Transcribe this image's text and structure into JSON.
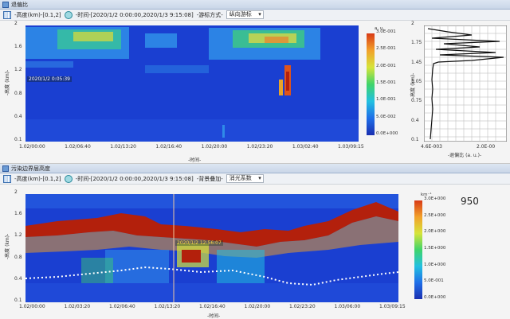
{
  "top": {
    "title": "退偏比",
    "toolbar": {
      "height_label": "-高度(km)-[0.1,2]",
      "time_label": "-时间-[2020/1/2 0:00:00,2020/1/3 9:15:08]",
      "cursor_label": "-游标方式-",
      "cursor_value": "纵向游标"
    },
    "ylabel": "-高度 (km)-",
    "xlabel": "-时间-",
    "yticks": [
      "2",
      "1.6",
      "1.2",
      "0.8",
      "0.4",
      "0.1"
    ],
    "xticks": [
      "1.02/00:00",
      "1.02/06:40",
      "1.02/13:20",
      "1.02/16:40",
      "1.02/20:00",
      "1.02/23:20",
      "1.03/02:40",
      "1.03/09:15"
    ],
    "stamp": "2020/1/2 0:05:39",
    "cbar_unit": "a. u.",
    "cbar_ticks": [
      "3.0E-001",
      "2.5E-001",
      "2.0E-001",
      "1.5E-001",
      "1.0E-001",
      "5.0E-002",
      "0.0E+000"
    ],
    "profile": {
      "yticks": [
        "2",
        "1.75",
        "1.45",
        "1.05",
        "0.75",
        "0.4",
        "0.1"
      ],
      "ylabel": "-高度 (km)-",
      "xticks": [
        "4.6E-003",
        "2.0E-00"
      ],
      "xlabel": "-退偏比 (a. u.)-"
    }
  },
  "bottom": {
    "title": "污染边界层高度",
    "toolbar": {
      "height_label": "-高度(km)-[0.1,2]",
      "time_label": "-时间-[2020/1/2 0:00:00,2020/1/3 9:15:08]",
      "bg_label": "-背景叠加-",
      "bg_value": "消光系数"
    },
    "ylabel": "-高度 (km)-",
    "xlabel": "-时间-",
    "yticks": [
      "2",
      "1.6",
      "1.2",
      "0.8",
      "0.4",
      "0.1"
    ],
    "xticks": [
      "1.02/00:00",
      "1.02/03:20",
      "1.02/06:40",
      "1.02/13:20",
      "1.02/16:40",
      "1.02/20:00",
      "1.02/23:20",
      "1.03/06:00",
      "1.03/09:15"
    ],
    "stamp": "2020/1/2 12:56:07",
    "cbar_unit": "km⁻¹",
    "cbar_ticks": [
      "3.0E+000",
      "2.5E+000",
      "2.0E+000",
      "1.5E+000",
      "1.0E+000",
      "5.0E-001",
      "0.0E+000"
    ],
    "side_number": "950"
  },
  "colors": {
    "plot_bg": "#1a3fd1",
    "aerosol_red": "#b3200c",
    "colormap": [
      "#1a2fb0",
      "#1f6ee8",
      "#22c0e0",
      "#3fd46a",
      "#d6e43a",
      "#f2a12a",
      "#d83a16"
    ]
  }
}
